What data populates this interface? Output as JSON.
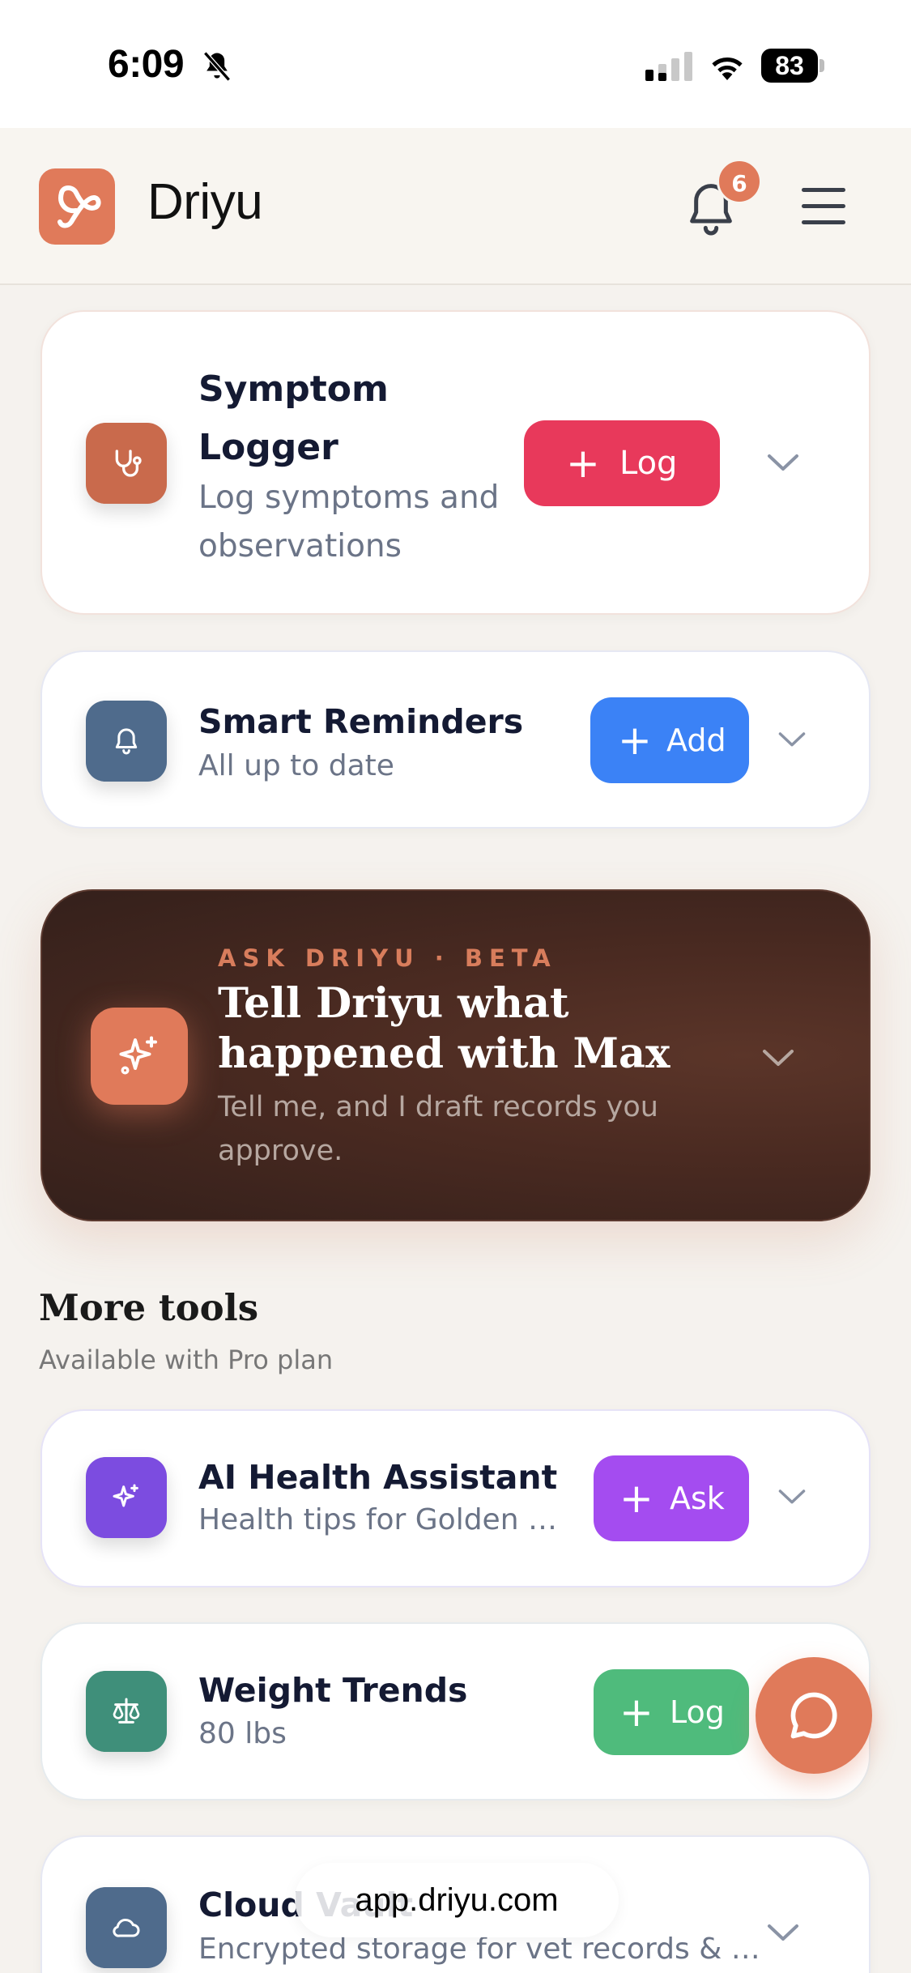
{
  "status_bar": {
    "time": "6:09",
    "battery": "83"
  },
  "app": {
    "name": "Driyu",
    "notification_count": "6"
  },
  "cards": {
    "symptom": {
      "title": "Symptom Logger",
      "subtitle": "Log symptoms and observations",
      "button": "Log",
      "icon": "stethoscope-icon",
      "color": "#c96a4c"
    },
    "reminders": {
      "title": "Smart Reminders",
      "subtitle": "All up to date",
      "button": "Add",
      "icon": "bell-icon",
      "color": "#4f6b8c"
    }
  },
  "ask": {
    "kicker": "ASK DRIYU · BETA",
    "title": "Tell Driyu what happened with Max",
    "subtitle": "Tell me, and I draft records you approve."
  },
  "more_tools": {
    "title": "More tools",
    "subtitle": "Available with Pro plan",
    "items": [
      {
        "title": "AI Health Assistant",
        "subtitle": "Health tips for Golden Retrievers",
        "button": "Ask",
        "icon": "sparkles-icon",
        "color": "#7c4ce0"
      },
      {
        "title": "Weight Trends",
        "subtitle": "80 lbs",
        "button": "Log",
        "icon": "scale-icon",
        "color": "#3f8f7a"
      },
      {
        "title": "Cloud Vault",
        "subtitle": "Encrypted storage for vet records & documents",
        "icon": "cloud-icon",
        "color": "#4f6b8c"
      }
    ]
  },
  "browser": {
    "url": "app.driyu.com"
  }
}
